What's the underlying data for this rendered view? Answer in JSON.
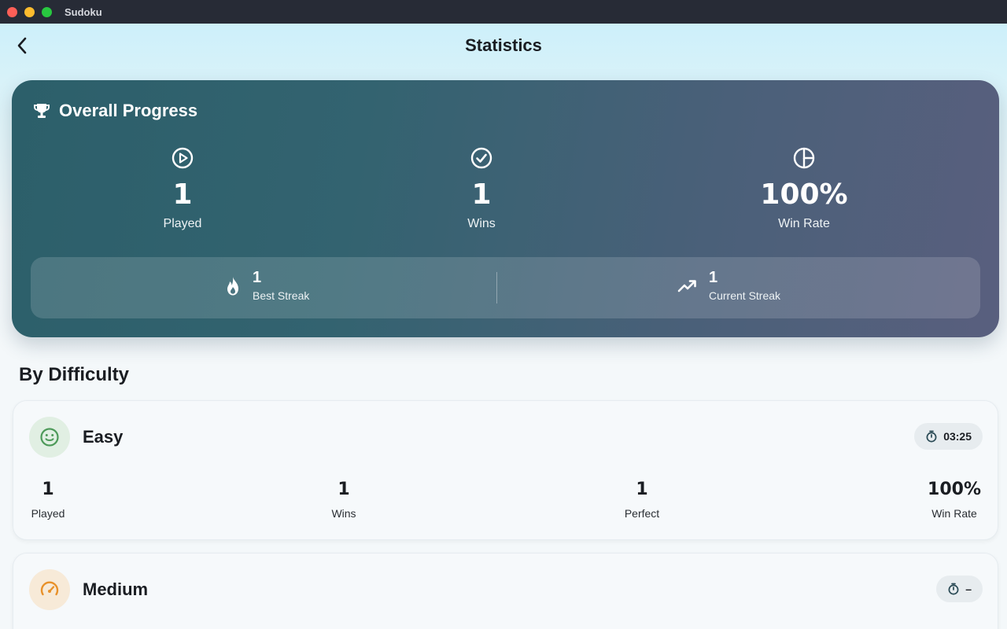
{
  "window": {
    "title": "Sudoku"
  },
  "header": {
    "title": "Statistics"
  },
  "overall": {
    "title": "Overall Progress",
    "stats": [
      {
        "icon": "play-circle-icon",
        "value": "1",
        "label": "Played"
      },
      {
        "icon": "check-circle-icon",
        "value": "1",
        "label": "Wins"
      },
      {
        "icon": "pie-chart-icon",
        "value": "100%",
        "label": "Win Rate"
      }
    ],
    "streaks": [
      {
        "icon": "flame-icon",
        "value": "1",
        "label": "Best Streak"
      },
      {
        "icon": "trending-up-icon",
        "value": "1",
        "label": "Current Streak"
      }
    ]
  },
  "difficulty": {
    "title": "By Difficulty",
    "levels": [
      {
        "name": "Easy",
        "icon": "smiley-icon",
        "color": "#4e9a5a",
        "icon_bg": "#e1efe3",
        "best_time": "03:25",
        "stats": [
          {
            "value": "1",
            "label": "Played"
          },
          {
            "value": "1",
            "label": "Wins"
          },
          {
            "value": "1",
            "label": "Perfect"
          },
          {
            "value": "100%",
            "label": "Win Rate"
          }
        ]
      },
      {
        "name": "Medium",
        "icon": "speedometer-icon",
        "color": "#e8912a",
        "icon_bg": "#f7ead8",
        "best_time": "–"
      }
    ]
  },
  "colors": {
    "card_gradient_start": "#2c5f6a",
    "card_gradient_end": "#595f7e",
    "accent": "#ffffff"
  }
}
